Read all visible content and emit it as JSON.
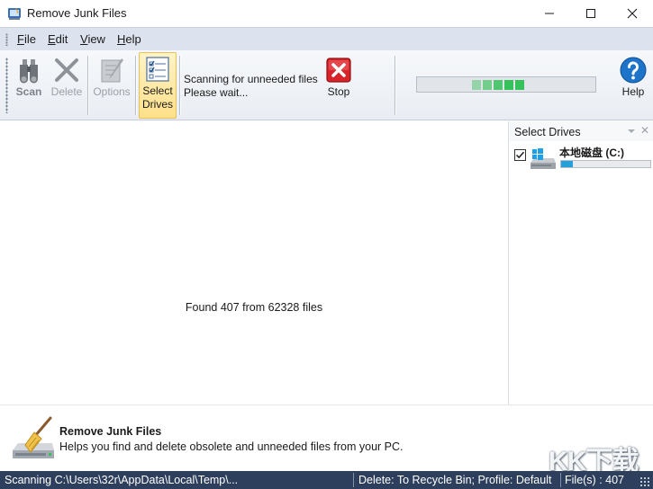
{
  "window": {
    "title": "Remove Junk Files",
    "minimize_icon": "minimize-icon",
    "maximize_icon": "maximize-icon",
    "close_icon": "close-icon"
  },
  "menu": {
    "items": [
      {
        "label": "File",
        "accel": "F",
        "rest": "ile"
      },
      {
        "label": "Edit",
        "accel": "E",
        "rest": "dit"
      },
      {
        "label": "View",
        "accel": "V",
        "rest": "iew"
      },
      {
        "label": "Help",
        "accel": "H",
        "rest": "elp"
      }
    ]
  },
  "toolbar": {
    "scan": {
      "label": "Scan",
      "icon": "binoculars-icon",
      "enabled": false
    },
    "delete": {
      "label": "Delete",
      "icon": "delete-x-icon",
      "enabled": false
    },
    "options": {
      "label": "Options",
      "icon": "options-icon",
      "enabled": false
    },
    "select_drives": {
      "label_line1": "Select",
      "label_line2": "Drives",
      "icon": "checklist-icon",
      "selected": true
    },
    "status_line1": "Scanning for unneeded files",
    "status_line2": "Please wait...",
    "stop": {
      "label": "Stop",
      "icon": "stop-icon"
    },
    "help": {
      "label": "Help",
      "icon": "help-icon"
    },
    "scan_progress_blocks": 5
  },
  "main": {
    "found_text": "Found 407 from 62328 files"
  },
  "drives_panel": {
    "title": "Select Drives",
    "drives": [
      {
        "name": "本地磁盘 (C:)",
        "checked": true,
        "usage_fraction": 0.13,
        "icon": "windows-drive-icon"
      }
    ]
  },
  "description": {
    "title": "Remove Junk Files",
    "text": "Helps you find and delete obsolete and unneeded files from your PC.",
    "icon": "broom-drive-icon",
    "watermark": "KK下载"
  },
  "statusbar": {
    "scanning_path": "Scanning C:\\Users\\32r\\AppData\\Local\\Temp\\...",
    "delete_mode": "Delete: To Recycle Bin; Profile: Default",
    "file_count": "File(s) : 407"
  },
  "colors": {
    "menubar": "#dde3ee",
    "statusbar": "#2d3f5c",
    "progress_green": "#37c15a",
    "drive_bar": "#26a0da"
  }
}
